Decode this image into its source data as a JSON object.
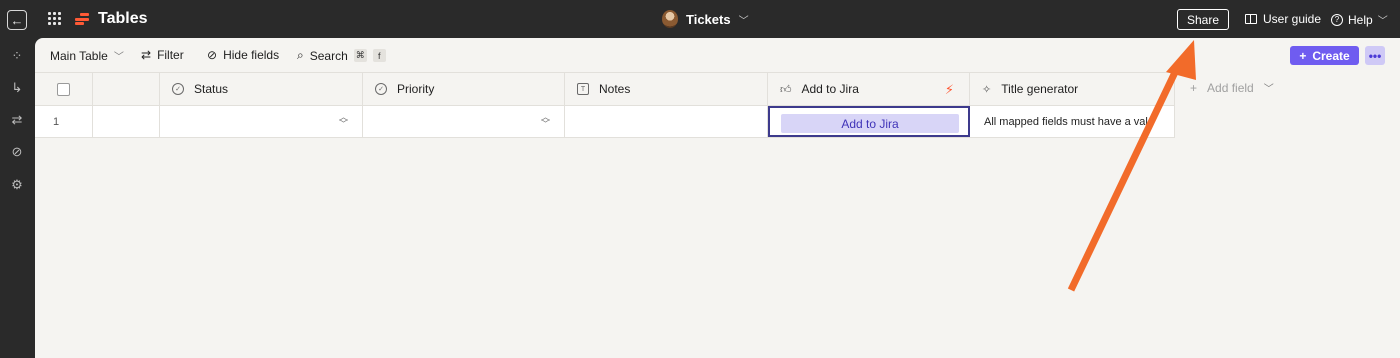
{
  "topbar": {
    "back_label": "←",
    "app_title": "Tables",
    "board_name": "Tickets",
    "share_label": "Share",
    "user_guide_label": "User guide",
    "help_label": "Help"
  },
  "toolbar": {
    "main_table_label": "Main Table",
    "filter_label": "Filter",
    "hide_fields_label": "Hide fields",
    "search_label": "Search",
    "search_kbd_1": "⌘",
    "search_kbd_2": "f",
    "create_label": "Create",
    "more_label": "•••"
  },
  "table": {
    "columns": [
      {
        "label": "Status",
        "icon": "status-icon"
      },
      {
        "label": "Priority",
        "icon": "priority-icon"
      },
      {
        "label": "Notes",
        "icon": "text-icon"
      },
      {
        "label": "Add to Jira",
        "icon": "thumbs-up-icon"
      },
      {
        "label": "Title generator",
        "icon": "ai-sparkle-icon"
      }
    ],
    "add_field_label": "Add field",
    "rows": [
      {
        "number": "1",
        "status": "",
        "priority": "",
        "notes": "",
        "jira_button": "Add to Jira",
        "title_generator": "All mapped fields must have a val"
      }
    ]
  },
  "colors": {
    "accent": "#6f5cf0",
    "arrow": "#f26b2a",
    "logo": "#ff5a36"
  }
}
